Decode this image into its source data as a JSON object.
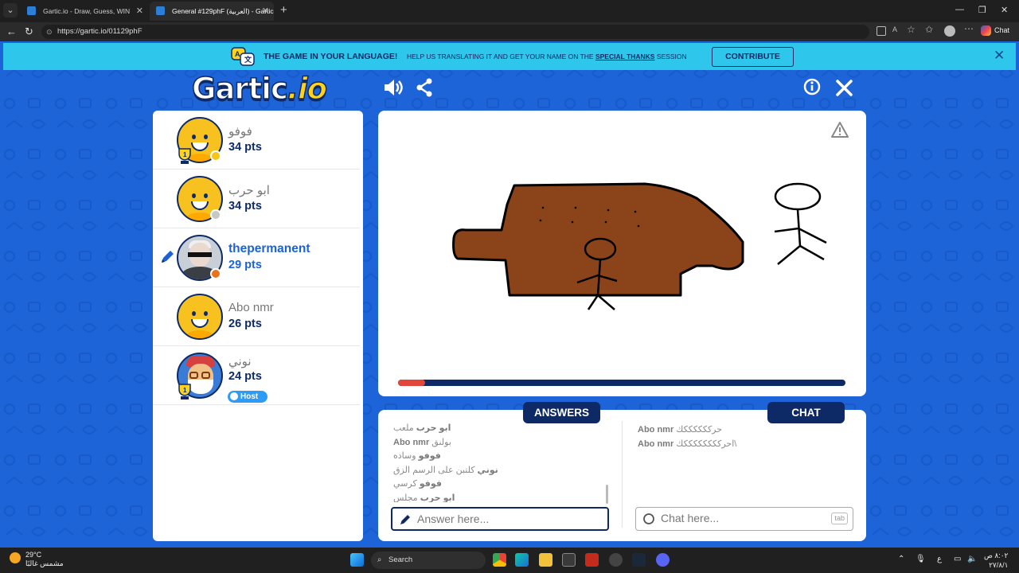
{
  "browser": {
    "tabs": [
      {
        "title": "Gartic.io - Draw, Guess, WIN",
        "active": false
      },
      {
        "title": "General #129phF (العربية) - Gartic.io",
        "active": true
      }
    ],
    "url": "https://gartic.io/01129phF",
    "copilot_label": "Chat"
  },
  "banner": {
    "headline": "THE GAME IN YOUR LANGUAGE!",
    "text_before": "HELP US TRANSLATING IT AND GET YOUR NAME ON THE",
    "link": "SPECIAL THANKS",
    "text_after": "SESSION",
    "button": "CONTRIBUTE"
  },
  "logo": {
    "main": "Gartic",
    "suffix": ".io"
  },
  "players": [
    {
      "name": "فوفو",
      "points": "34 pts",
      "status_color": "#f5c518",
      "trophy": true,
      "avatar": "smiley",
      "current": false
    },
    {
      "name": "ابو حرب",
      "points": "34 pts",
      "status_color": "#c7c7c7",
      "trophy": false,
      "avatar": "smiley",
      "current": false
    },
    {
      "name": "thepermanent",
      "points": "29 pts",
      "status_color": "#e8731f",
      "trophy": false,
      "avatar": "photo",
      "current": true
    },
    {
      "name": "Abo nmr",
      "points": "26 pts",
      "status_color": null,
      "trophy": false,
      "avatar": "smiley",
      "current": false
    },
    {
      "name": "نوني",
      "points": "24 pts",
      "status_color": null,
      "trophy": true,
      "avatar": "host",
      "current": false,
      "badge": "Host"
    }
  ],
  "round": {
    "progress": 0.06
  },
  "answers": {
    "tab_label": "ANSWERS",
    "messages": [
      {
        "user": "ابو حرب",
        "text": "ملعب"
      },
      {
        "user": "Abo nmr",
        "text": "بولنق"
      },
      {
        "user": "فوفو",
        "text": "وساده"
      },
      {
        "user": "نوني",
        "text": "كلتبن على الرسم الزق"
      },
      {
        "user": "فوفو",
        "text": "كرسي"
      },
      {
        "user": "ابو حرب",
        "text": "مجلس"
      }
    ],
    "placeholder": "Answer here..."
  },
  "chat": {
    "tab_label": "CHAT",
    "messages": [
      {
        "user": "Abo nmr",
        "text": "حرككككككك"
      },
      {
        "user": "Abo nmr",
        "text": "احرككككككككك\\"
      }
    ],
    "placeholder": "Chat here...",
    "key_hint": "tab"
  },
  "taskbar": {
    "temperature": "29°C",
    "weather": "مشمس غالبًا",
    "search": "Search",
    "keyboard": "ع",
    "time": "٨:٠٢ ص",
    "date": "٢٧/٨/١"
  }
}
